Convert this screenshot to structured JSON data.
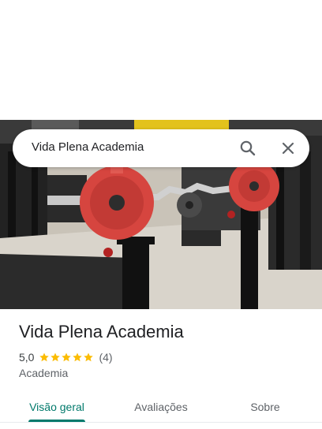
{
  "search": {
    "query": "Vida Plena Academia"
  },
  "place": {
    "title": "Vida Plena Academia",
    "rating": "5,0",
    "stars": 5,
    "review_count": "(4)",
    "category": "Academia"
  },
  "tabs": [
    {
      "label": "Visão geral",
      "active": true
    },
    {
      "label": "Avaliações",
      "active": false
    },
    {
      "label": "Sobre",
      "active": false
    }
  ],
  "colors": {
    "accent": "#00796b",
    "star": "#fbbc04",
    "plate": "#d6453f"
  },
  "icons": [
    "search-icon",
    "close-icon",
    "star-icon"
  ]
}
